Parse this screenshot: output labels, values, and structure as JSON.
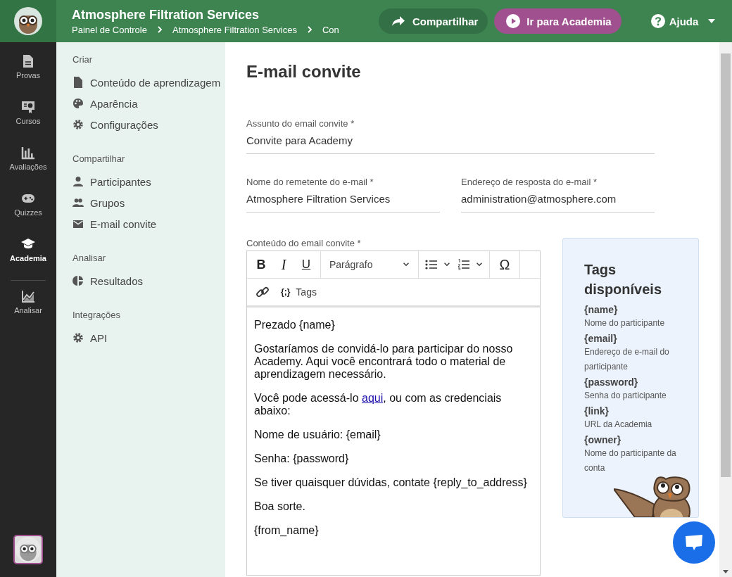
{
  "header": {
    "title": "Atmosphere Filtration Services",
    "breadcrumb": [
      "Painel de Controle",
      "Atmosphere Filtration Services",
      "Con"
    ],
    "share_button": "Compartilhar",
    "academy_button": "Ir para Academia",
    "help_button": "Ajuda"
  },
  "rail": {
    "items": [
      {
        "label": "Provas",
        "selected": false
      },
      {
        "label": "Cursos",
        "selected": false
      },
      {
        "label": "Avaliações",
        "selected": false
      },
      {
        "label": "Quizzes",
        "selected": false
      },
      {
        "label": "Academia",
        "selected": true
      },
      {
        "label": "Analisar",
        "selected": false
      }
    ]
  },
  "submenu": {
    "sections": [
      {
        "heading": "Criar",
        "items": [
          "Conteúdo de aprendizagem",
          "Aparência",
          "Configurações"
        ]
      },
      {
        "heading": "Compartilhar",
        "items": [
          "Participantes",
          "Grupos",
          "E-mail convite"
        ]
      },
      {
        "heading": "Analisar",
        "items": [
          "Resultados"
        ]
      },
      {
        "heading": "Integrações",
        "items": [
          "API"
        ]
      }
    ]
  },
  "main": {
    "title": "E-mail convite",
    "field_rows": [
      [
        {
          "label": "Assunto do email convite *",
          "value": "Convite para Academy"
        }
      ],
      [
        {
          "label": "Nome do remetente do e-mail *",
          "value": "Atmosphere Filtration Services"
        },
        {
          "label": "Endereço de resposta do e-mail *",
          "value": "administration@atmosphere.com"
        }
      ]
    ],
    "editor": {
      "label": "Conteúdo do email convite *",
      "toolbar": {
        "bold": "B",
        "italic": "I",
        "underline": "U",
        "format": "Parágrafo",
        "symbol": "Ω",
        "tags_glyph": "{;}",
        "tags": "Tags"
      },
      "paragraphs": [
        [
          {
            "text": "Prezado {name}"
          }
        ],
        [
          {
            "text": "Gostaríamos de convidá-lo para participar do nosso Academy. Aqui você encontrará todo o material de aprendizagem necessário."
          }
        ],
        [
          {
            "text": "Você pode acessá-lo "
          },
          {
            "text": "aqui",
            "link": true
          },
          {
            "text": ", ou com as credenciais abaixo:"
          }
        ],
        [
          {
            "text": "Nome de usuário: {email}"
          }
        ],
        [
          {
            "text": "Senha: {password}"
          }
        ],
        [
          {
            "text": "Se tiver quaisquer dúvidas, contate {reply_to_address}"
          }
        ],
        [
          {
            "text": "Boa sorte."
          }
        ],
        [
          {
            "text": "{from_name}"
          }
        ]
      ]
    },
    "tags_panel": {
      "title": "Tags disponíveis",
      "tags": [
        {
          "tag": "{name}",
          "description": "Nome do participante"
        },
        {
          "tag": "{email}",
          "description": "Endereço de e-mail do participante"
        },
        {
          "tag": "{password}",
          "description": "Senha do participante"
        },
        {
          "tag": "{link}",
          "description": "URL da Academia"
        },
        {
          "tag": "{owner}",
          "description": "Nome do participante da conta"
        }
      ]
    }
  }
}
